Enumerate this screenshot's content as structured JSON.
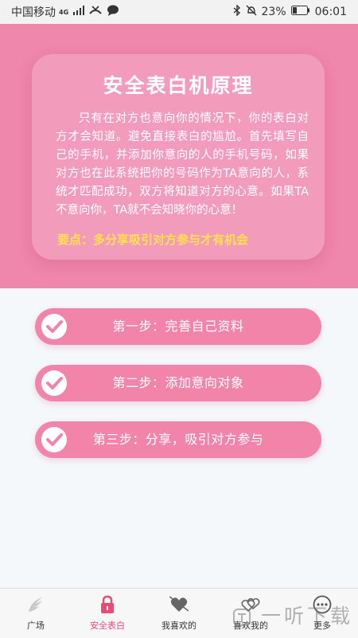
{
  "status_bar": {
    "carrier": "中国移动",
    "network": "4G",
    "battery": "23%",
    "time": "06:01"
  },
  "card": {
    "title": "安全表白机原理",
    "body": "只有在对方也意向你的情况下，你的表白对方才会知道。避免直接表白的尴尬。首先填写自己的手机，并添加你意向的人的手机号码，如果对方也在此系统把你的号码作为TA意向的人，系统才匹配成功，双方将知道对方的心意。如果TA不意向你，TA就不会知晓你的心意！",
    "key_point": "要点：多分享吸引对方参与才有机会"
  },
  "steps": [
    {
      "label": "第一步：完善自己资料"
    },
    {
      "label": "第二步：添加意向对象"
    },
    {
      "label": "第三步：分享，吸引对方参与"
    }
  ],
  "tabs": [
    {
      "label": "广场",
      "icon": "wing-icon"
    },
    {
      "label": "安全表白",
      "icon": "lock-icon",
      "active": true
    },
    {
      "label": "我喜欢的",
      "icon": "heart-arrow-icon"
    },
    {
      "label": "喜欢我的",
      "icon": "hearts-icon"
    },
    {
      "label": "更多",
      "icon": "more-icon"
    }
  ],
  "watermark": "一听下载",
  "colors": {
    "primary": "#ef86ab",
    "active_tab": "#e84a7a",
    "key_point": "#ffe14a",
    "background": "#f4f8fb"
  }
}
